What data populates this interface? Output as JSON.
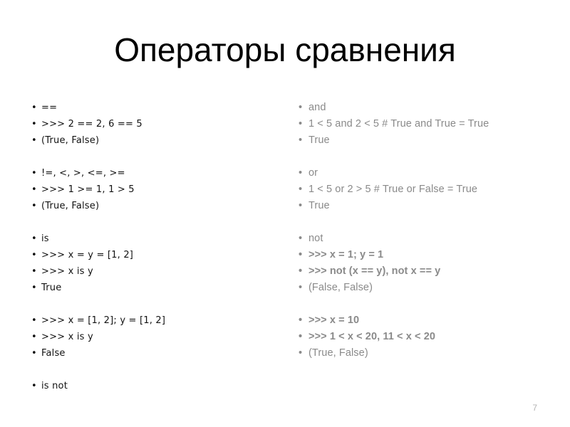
{
  "slide": {
    "title": "Операторы сравнения",
    "page_number": "7",
    "bullet_glyph": "•",
    "colors": {
      "title": "#000000",
      "left_text": "#121212",
      "right_text": "#8a8a8a",
      "right_text_strong": "#6e6e6e",
      "page_number": "#b3b3b3",
      "background": "#ffffff"
    }
  },
  "left_column": {
    "items": [
      {
        "text": "==",
        "type": "bullet"
      },
      {
        "text": ">>> 2 == 2, 6 == 5",
        "type": "bullet"
      },
      {
        "text": "(True, False)",
        "type": "bullet"
      },
      {
        "text": "",
        "type": "spacer"
      },
      {
        "text": "!=, <, >, <=, >=",
        "type": "bullet"
      },
      {
        "text": ">>> 1 >= 1, 1 > 5",
        "type": "bullet"
      },
      {
        "text": "(True, False)",
        "type": "bullet"
      },
      {
        "text": "",
        "type": "spacer"
      },
      {
        "text": "is",
        "type": "bullet"
      },
      {
        "text": ">>> x = y = [1, 2]",
        "type": "bullet"
      },
      {
        "text": ">>> x is y",
        "type": "bullet"
      },
      {
        "text": "True",
        "type": "bullet"
      },
      {
        "text": "",
        "type": "spacer"
      },
      {
        "text": ">>> x = [1, 2]; y = [1, 2]",
        "type": "bullet"
      },
      {
        "text": ">>> x is y",
        "type": "bullet"
      },
      {
        "text": "False",
        "type": "bullet"
      },
      {
        "text": "",
        "type": "spacer"
      },
      {
        "text": "is not",
        "type": "bullet"
      }
    ]
  },
  "right_column": {
    "items": [
      {
        "text": "and",
        "type": "bullet",
        "emphasis": "normal"
      },
      {
        "text": "1 < 5 and 2 < 5 # True and True = True",
        "type": "bullet",
        "emphasis": "normal"
      },
      {
        "text": "True",
        "type": "bullet",
        "emphasis": "normal"
      },
      {
        "text": "",
        "type": "spacer",
        "emphasis": "normal"
      },
      {
        "text": "or",
        "type": "bullet",
        "emphasis": "normal"
      },
      {
        "text": "1 < 5 or 2 > 5 # True or False = True",
        "type": "bullet",
        "emphasis": "normal"
      },
      {
        "text": "True",
        "type": "bullet",
        "emphasis": "normal"
      },
      {
        "text": "",
        "type": "spacer",
        "emphasis": "normal"
      },
      {
        "text": "not",
        "type": "bullet",
        "emphasis": "normal"
      },
      {
        "text": ">>> x = 1; y = 1",
        "type": "bullet",
        "emphasis": "strong"
      },
      {
        "text": ">>> not (x == y), not x == y",
        "type": "bullet",
        "emphasis": "strong"
      },
      {
        "text": "(False, False)",
        "type": "bullet",
        "emphasis": "semi"
      },
      {
        "text": "",
        "type": "spacer",
        "emphasis": "normal"
      },
      {
        "text": ">>> x = 10",
        "type": "bullet",
        "emphasis": "strong"
      },
      {
        "text": ">>> 1 < x < 20, 11 < x < 20",
        "type": "bullet",
        "emphasis": "strong"
      },
      {
        "text": "(True, False)",
        "type": "bullet",
        "emphasis": "semi"
      }
    ]
  }
}
